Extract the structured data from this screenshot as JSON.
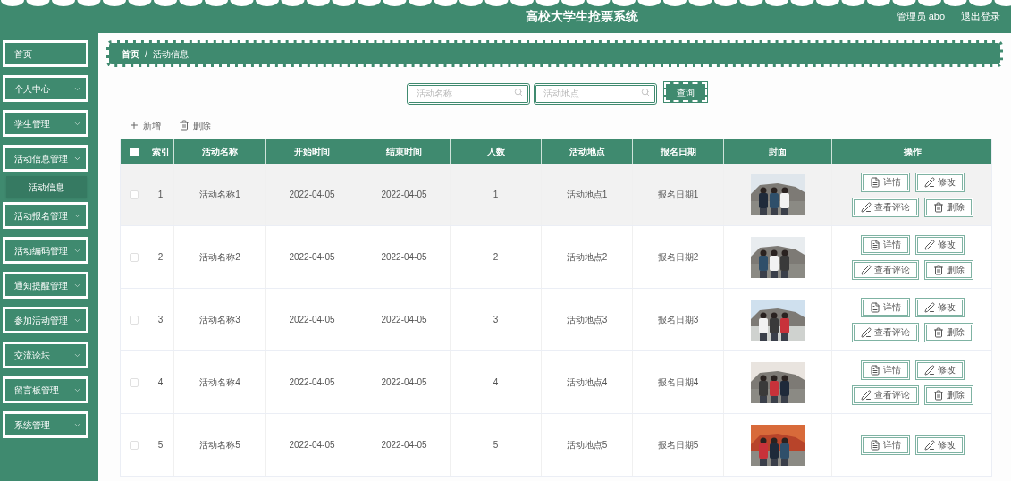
{
  "header": {
    "title": "高校大学生抢票系统",
    "user": "管理员 abo",
    "logout": "退出登录"
  },
  "sidebar": {
    "items": [
      {
        "label": "首页",
        "kind": "link"
      },
      {
        "label": "个人中心",
        "kind": "menu",
        "expanded": false
      },
      {
        "label": "学生管理",
        "kind": "menu",
        "expanded": false
      },
      {
        "label": "活动信息管理",
        "kind": "menu",
        "expanded": true,
        "children": [
          {
            "label": "活动信息",
            "selected": true
          }
        ]
      },
      {
        "label": "活动报名管理",
        "kind": "menu",
        "expanded": false
      },
      {
        "label": "活动编码管理",
        "kind": "menu",
        "expanded": false
      },
      {
        "label": "通知提醒管理",
        "kind": "menu",
        "expanded": false
      },
      {
        "label": "参加活动管理",
        "kind": "menu",
        "expanded": false
      },
      {
        "label": "交流论坛",
        "kind": "menu",
        "expanded": false
      },
      {
        "label": "留言板管理",
        "kind": "menu",
        "expanded": false
      },
      {
        "label": "系统管理",
        "kind": "menu",
        "expanded": false
      }
    ]
  },
  "breadcrumb": {
    "items": [
      "首页",
      "活动信息"
    ],
    "separator": "/"
  },
  "search": {
    "fields": [
      {
        "placeholder": "活动名称"
      },
      {
        "placeholder": "活动地点"
      }
    ],
    "button": "查询"
  },
  "toolbar": [
    {
      "kind": "add",
      "label": "新增"
    },
    {
      "kind": "delete",
      "label": "删除"
    }
  ],
  "table": {
    "select_all": {
      "checked": false
    },
    "columns": [
      "索引",
      "活动名称",
      "开始时间",
      "结束时间",
      "人数",
      "活动地点",
      "报名日期",
      "封面",
      "操作"
    ],
    "rows": [
      {
        "selected": true,
        "checked": false,
        "cells": [
          "1",
          "活动名称1",
          "2022-04-05",
          "2022-04-05",
          "1",
          "活动地点1",
          "报名日期1"
        ],
        "cover": {
          "kind": "picture"
        },
        "actions": [
          {
            "kind": "detail",
            "label": "详情"
          },
          {
            "kind": "edit",
            "label": "修改"
          },
          {
            "kind": "comment",
            "label": "查看评论"
          },
          {
            "kind": "delete",
            "label": "删除"
          }
        ]
      },
      {
        "selected": false,
        "checked": false,
        "cells": [
          "2",
          "活动名称2",
          "2022-04-05",
          "2022-04-05",
          "2",
          "活动地点2",
          "报名日期2"
        ],
        "cover": {
          "kind": "picture"
        },
        "actions": [
          {
            "kind": "detail",
            "label": "详情"
          },
          {
            "kind": "edit",
            "label": "修改"
          },
          {
            "kind": "comment",
            "label": "查看评论"
          },
          {
            "kind": "delete",
            "label": "删除"
          }
        ]
      },
      {
        "selected": false,
        "checked": false,
        "cells": [
          "3",
          "活动名称3",
          "2022-04-05",
          "2022-04-05",
          "3",
          "活动地点3",
          "报名日期3"
        ],
        "cover": {
          "kind": "picture"
        },
        "actions": [
          {
            "kind": "detail",
            "label": "详情"
          },
          {
            "kind": "edit",
            "label": "修改"
          },
          {
            "kind": "comment",
            "label": "查看评论"
          },
          {
            "kind": "delete",
            "label": "删除"
          }
        ]
      },
      {
        "selected": false,
        "checked": false,
        "cells": [
          "4",
          "活动名称4",
          "2022-04-05",
          "2022-04-05",
          "4",
          "活动地点4",
          "报名日期4"
        ],
        "cover": {
          "kind": "picture"
        },
        "actions": [
          {
            "kind": "detail",
            "label": "详情"
          },
          {
            "kind": "edit",
            "label": "修改"
          },
          {
            "kind": "comment",
            "label": "查看评论"
          },
          {
            "kind": "delete",
            "label": "删除"
          }
        ]
      },
      {
        "selected": false,
        "checked": false,
        "cells": [
          "5",
          "活动名称5",
          "2022-04-05",
          "2022-04-05",
          "5",
          "活动地点5",
          "报名日期5"
        ],
        "cover": {
          "kind": "picture"
        },
        "actions": [
          {
            "kind": "detail",
            "label": "详情"
          },
          {
            "kind": "edit",
            "label": "修改"
          }
        ]
      }
    ]
  }
}
